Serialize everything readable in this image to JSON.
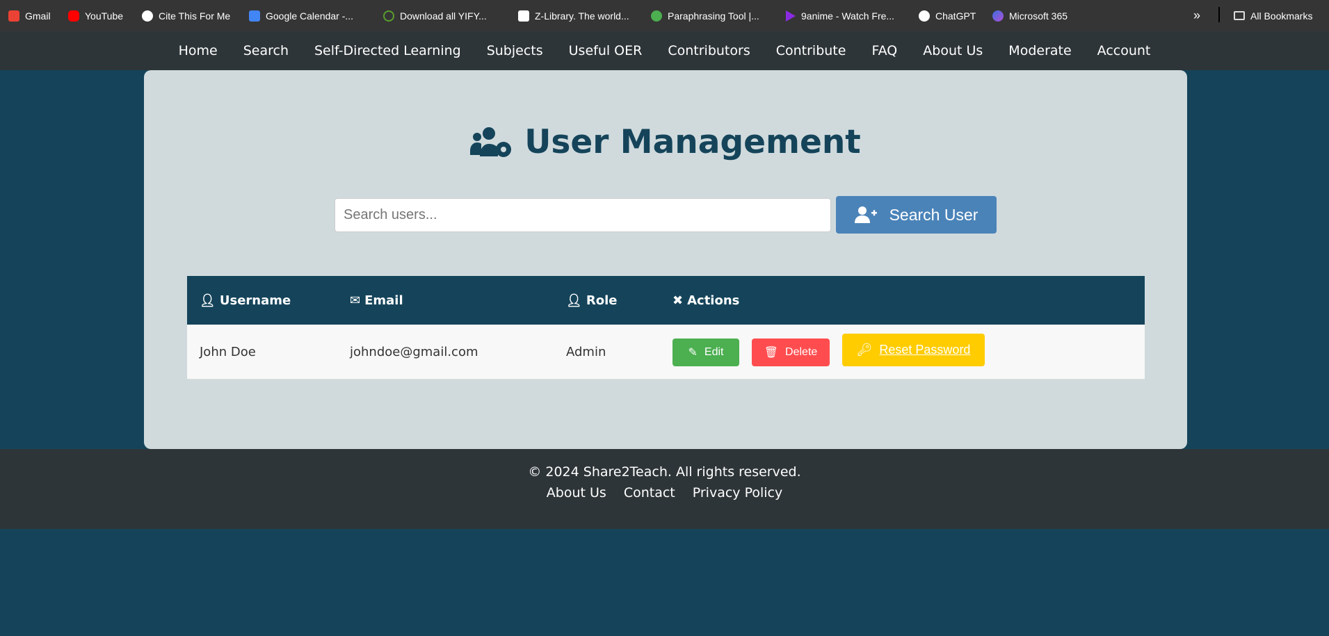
{
  "bookmarks": [
    {
      "label": "Gmail",
      "color": "#ea4335"
    },
    {
      "label": "YouTube",
      "color": "#ff0000"
    },
    {
      "label": "Cite This For Me",
      "color": "#ffffff"
    },
    {
      "label": "Google Calendar -...",
      "color": "#4285f4"
    },
    {
      "label": "Download all YIFY...",
      "color": "#5a9e2f"
    },
    {
      "label": "Z-Library. The world...",
      "color": "#ffffff"
    },
    {
      "label": "Paraphrasing Tool |...",
      "color": "#4caf50"
    },
    {
      "label": "9anime - Watch Fre...",
      "color": "#8a2be2"
    },
    {
      "label": "ChatGPT",
      "color": "#ffffff"
    },
    {
      "label": "Microsoft 365",
      "color": "#3b6fe0"
    }
  ],
  "all_bookmarks": "All Bookmarks",
  "overflow": "»",
  "nav": [
    "Home",
    "Search",
    "Self-Directed Learning",
    "Subjects",
    "Useful OER",
    "Contributors",
    "Contribute",
    "FAQ",
    "About Us",
    "Moderate",
    "Account"
  ],
  "page_title": "User Management",
  "search": {
    "placeholder": "Search users...",
    "value": "",
    "button": "Search User"
  },
  "table": {
    "headers": [
      "Username",
      "Email",
      "Role",
      "Actions"
    ],
    "rows": [
      {
        "username": "John Doe",
        "email": "johndoe@gmail.com",
        "role": "Admin"
      }
    ],
    "actions": {
      "edit": "Edit",
      "delete": "Delete",
      "reset": "Reset Password"
    }
  },
  "footer": {
    "copyright": "© 2024 Share2Teach. All rights reserved.",
    "links": [
      "About Us",
      "Contact",
      "Privacy Policy"
    ]
  },
  "colors": {
    "primary": "#15445a",
    "edit": "#4caf50",
    "delete": "#ff4d4f",
    "reset": "#ffcc00",
    "search": "#4a83b8"
  }
}
